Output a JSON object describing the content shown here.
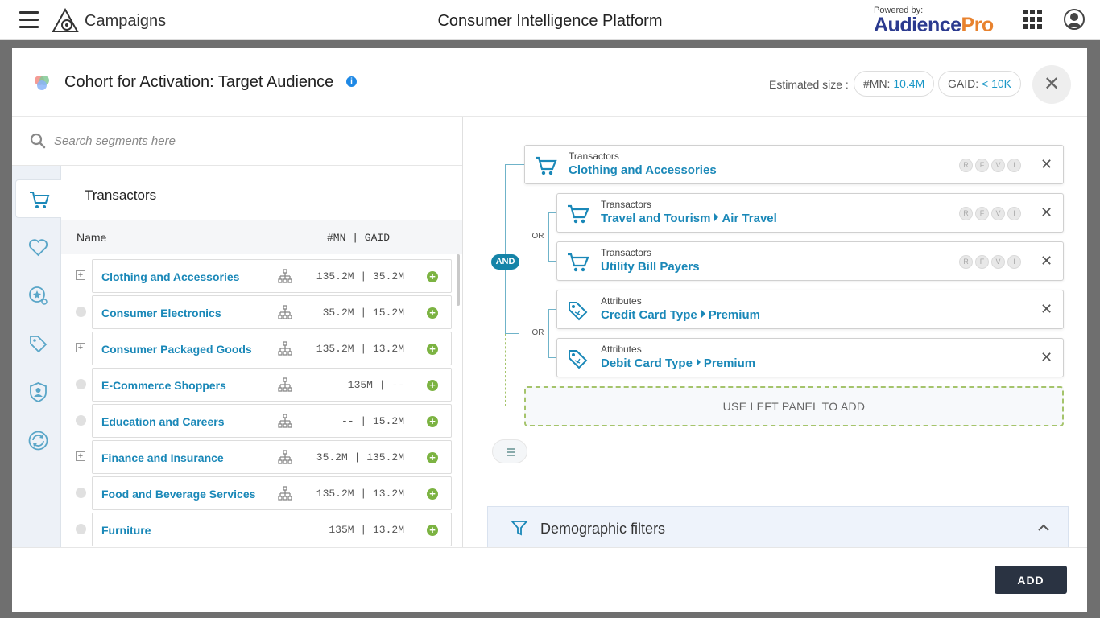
{
  "topbar": {
    "app_name": "Campaigns",
    "platform_title": "Consumer Intelligence Platform",
    "powered_by": "Powered by:",
    "brand_part1": "Audience",
    "brand_part2": "Pro"
  },
  "modal": {
    "title": "Cohort for Activation: Target Audience",
    "info_symbol": "i",
    "estimated_label": "Estimated size :",
    "mn_label": "#MN:",
    "mn_value": "10.4M",
    "gaid_label": "GAID:",
    "gaid_value": "< 10K",
    "close_symbol": "✕"
  },
  "search": {
    "placeholder": "Search segments here"
  },
  "side_tabs": [
    "cart-icon",
    "heart-icon",
    "badge-search-icon",
    "tags-icon",
    "person-shield-icon",
    "refresh-icon"
  ],
  "list": {
    "title": "Transactors",
    "col_name": "Name",
    "col_counts": "#MN | GAID",
    "rows": [
      {
        "name": "Clothing and Accessories",
        "expandable": true,
        "tree": true,
        "counts": "135.2M | 35.2M"
      },
      {
        "name": "Consumer Electronics",
        "expandable": false,
        "tree": true,
        "counts": "35.2M | 15.2M"
      },
      {
        "name": "Consumer Packaged Goods",
        "expandable": true,
        "tree": true,
        "counts": "135.2M | 13.2M"
      },
      {
        "name": "E-Commerce Shoppers",
        "expandable": false,
        "tree": true,
        "counts": "135M | --"
      },
      {
        "name": "Education and Careers",
        "expandable": false,
        "tree": true,
        "counts": "-- | 15.2M"
      },
      {
        "name": "Finance and Insurance",
        "expandable": true,
        "tree": true,
        "counts": "35.2M | 135.2M"
      },
      {
        "name": "Food and Beverage Services",
        "expandable": false,
        "tree": true,
        "counts": "135.2M | 13.2M"
      },
      {
        "name": "Furniture",
        "expandable": false,
        "tree": false,
        "counts": "135M | 13.2M"
      }
    ]
  },
  "builder": {
    "and_label": "AND",
    "or_label": "OR",
    "rfvi": [
      "R",
      "F",
      "V",
      "I"
    ],
    "rules": [
      {
        "category": "Transactors",
        "name": "Clothing and Accessories",
        "sub": "",
        "icon": "cart-icon",
        "rfvi": true
      },
      {
        "category": "Transactors",
        "name": "Travel and Tourism",
        "sub": "Air Travel",
        "icon": "cart-icon",
        "rfvi": true
      },
      {
        "category": "Transactors",
        "name": "Utility Bill Payers",
        "sub": "",
        "icon": "cart-icon",
        "rfvi": true
      },
      {
        "category": "Attributes",
        "name": "Credit Card Type",
        "sub": "Premium",
        "icon": "tag-icon",
        "rfvi": false
      },
      {
        "category": "Attributes",
        "name": "Debit Card Type",
        "sub": "Premium",
        "icon": "tag-icon",
        "rfvi": false
      }
    ],
    "placeholder": "USE LEFT PANEL TO ADD",
    "demographic_label": "Demographic filters"
  },
  "footer": {
    "add_label": "ADD"
  },
  "colors": {
    "accent": "#1a88b8",
    "and_badge": "#1584a8",
    "add_green": "#7cb342",
    "button_dark": "#2a3342"
  }
}
